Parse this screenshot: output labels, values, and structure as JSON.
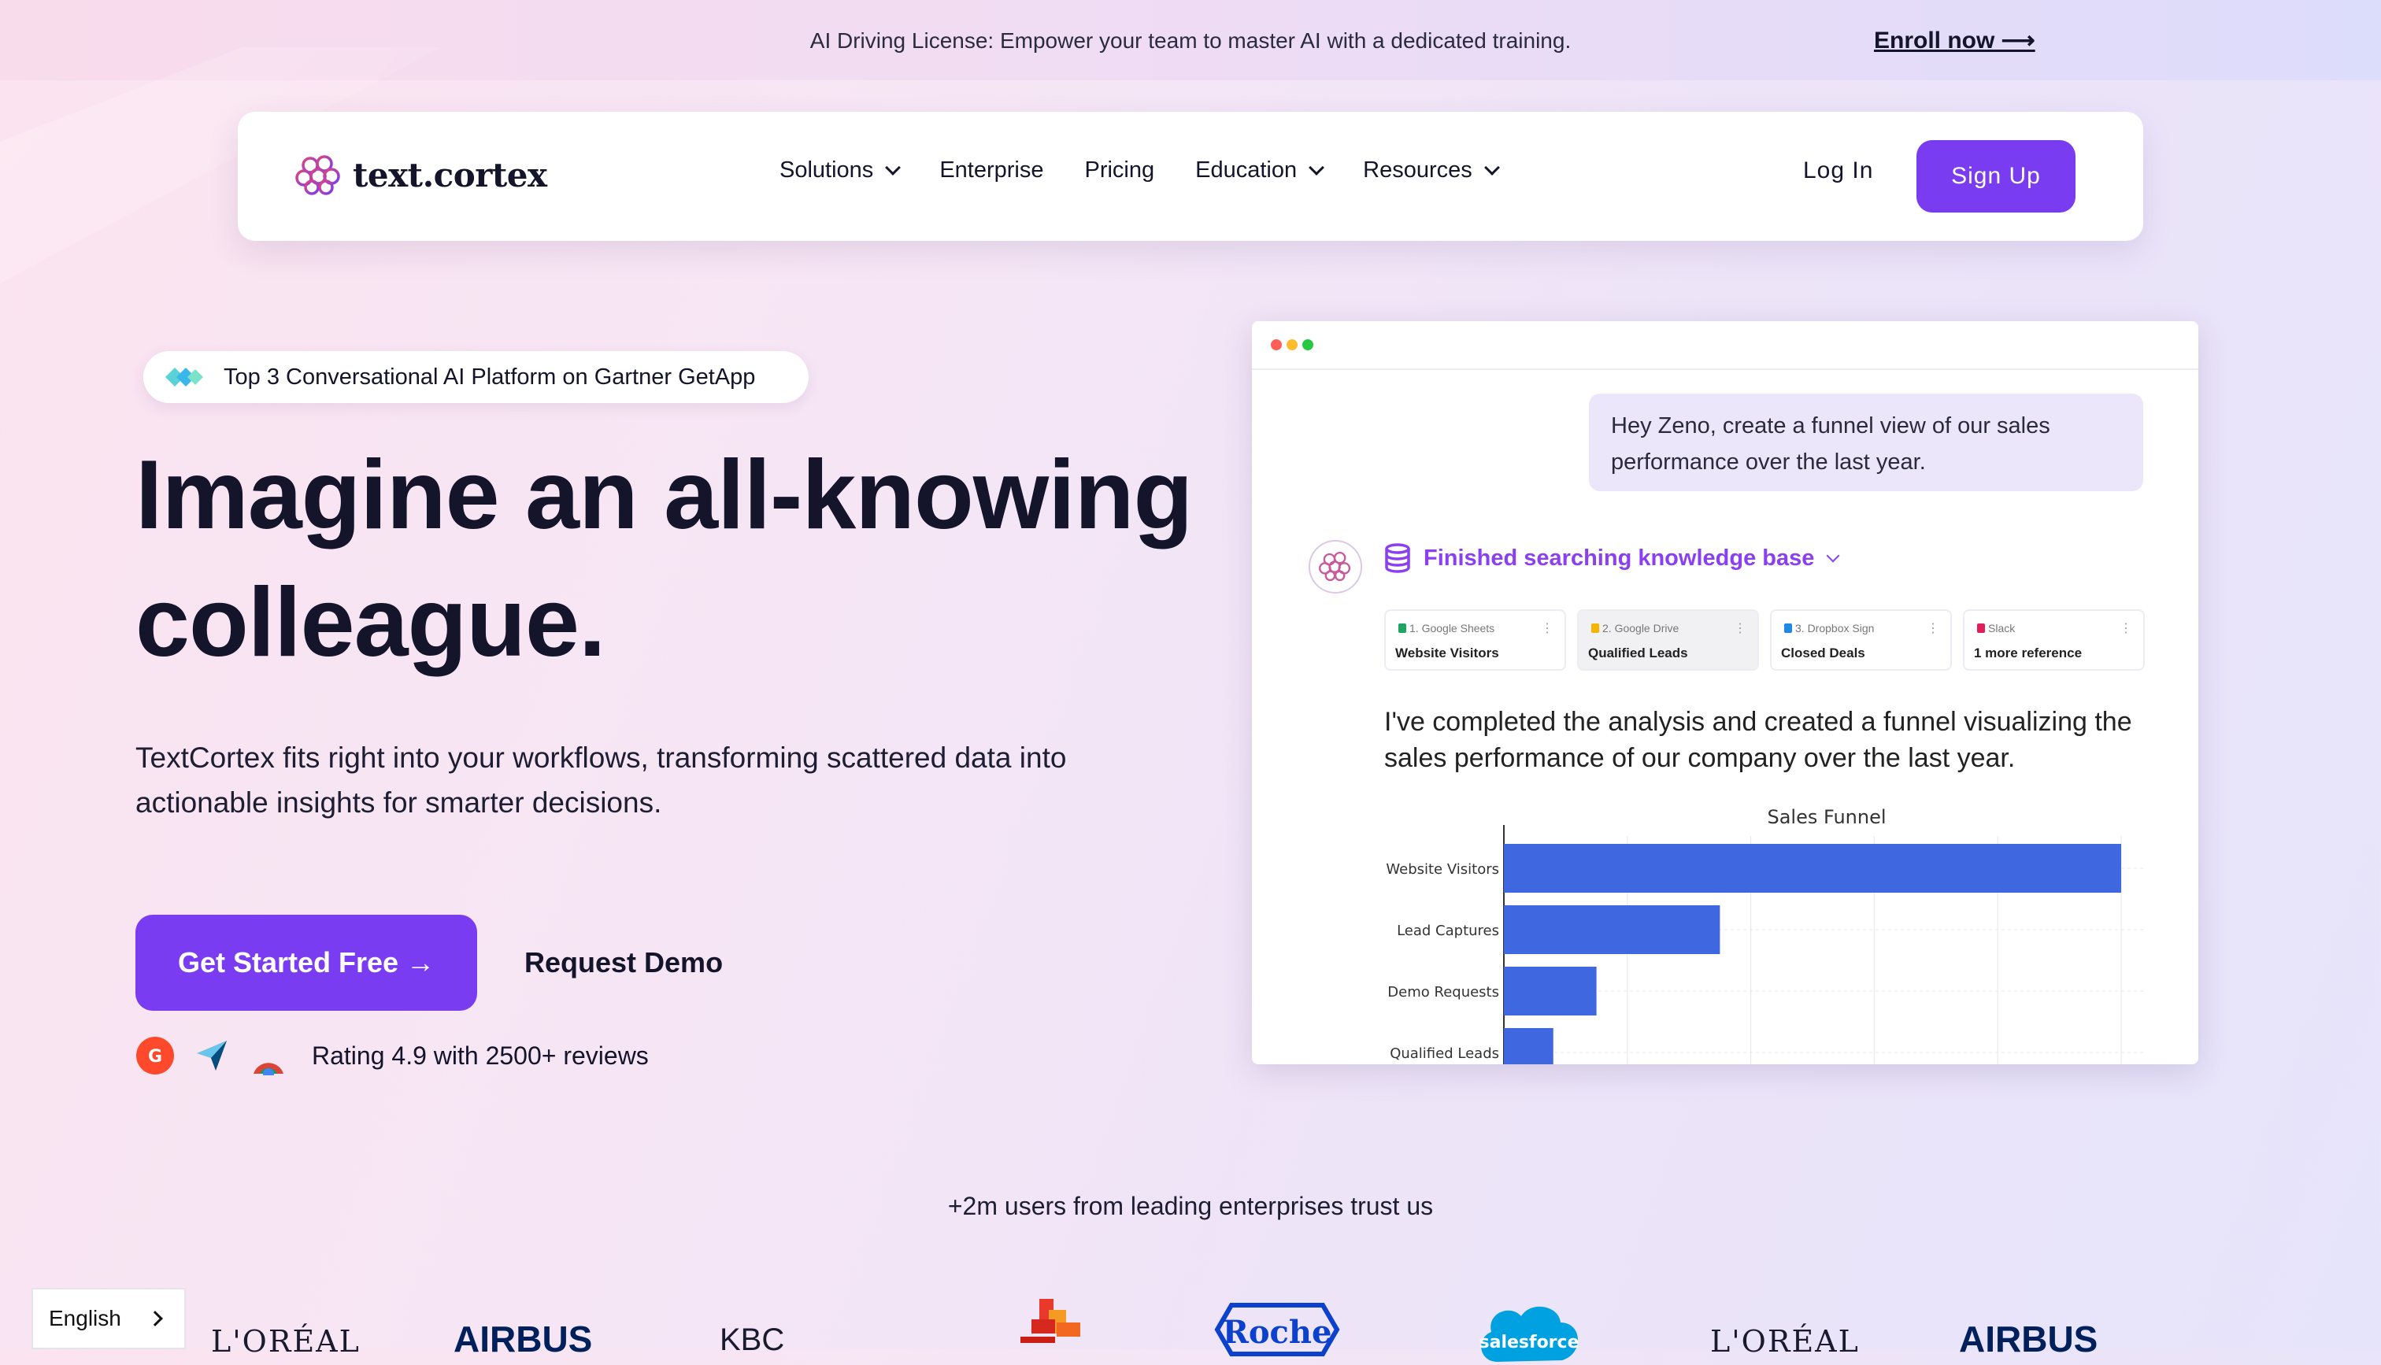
{
  "announcement": {
    "text": "AI Driving License: Empower your team to master AI with a dedicated training.",
    "link": "Enroll now ⟶"
  },
  "nav": {
    "logo": "text.cortex",
    "items": [
      {
        "label": "Solutions",
        "dropdown": true
      },
      {
        "label": "Enterprise",
        "dropdown": false
      },
      {
        "label": "Pricing",
        "dropdown": false
      },
      {
        "label": "Education",
        "dropdown": true
      },
      {
        "label": "Resources",
        "dropdown": true
      }
    ],
    "login": "Log In",
    "signup": "Sign Up"
  },
  "hero": {
    "badge": "Top 3 Conversational AI Platform on Gartner GetApp",
    "title_line1": "Imagine an all-knowing",
    "title_line2": "colleague.",
    "subtitle": "TextCortex fits right into your workflows, transforming scattered data into actionable insights for smarter decisions.",
    "cta": "Get Started Free →",
    "demo": "Request Demo",
    "rating": "Rating 4.9 with 2500+ reviews"
  },
  "demo_window": {
    "prompt": "Hey Zeno, create a funnel view of our sales performance over the last year.",
    "status": "Finished searching knowledge base",
    "references": [
      {
        "source": "1. Google Sheets",
        "name": "Website Visitors",
        "color": "#1fa463"
      },
      {
        "source": "2. Google Drive",
        "name": "Qualified Leads",
        "color": "#f4b400"
      },
      {
        "source": "3. Dropbox Sign",
        "name": "Closed Deals",
        "color": "#1e88e5"
      },
      {
        "source": "Slack",
        "name": "1 more reference",
        "color": "#e01e5a"
      }
    ],
    "answer": "I've completed the analysis and created a funnel visualizing the sales performance of our company over the last year."
  },
  "chart_data": {
    "type": "bar",
    "orientation": "horizontal",
    "title": "Sales Funnel",
    "categories": [
      "Website Visitors",
      "Lead Captures",
      "Demo Requests",
      "Qualified Leads"
    ],
    "values": [
      100,
      35,
      15,
      8
    ],
    "color": "#3f67e0",
    "grid": true
  },
  "trust": {
    "text": "+2m users from leading enterprises trust us",
    "logos": [
      "L'ORÉAL",
      "AIRBUS",
      "KBC",
      "Roche",
      "salesforce",
      "L'ORÉAL",
      "AIRBUS"
    ]
  },
  "language": {
    "selected": "English"
  }
}
